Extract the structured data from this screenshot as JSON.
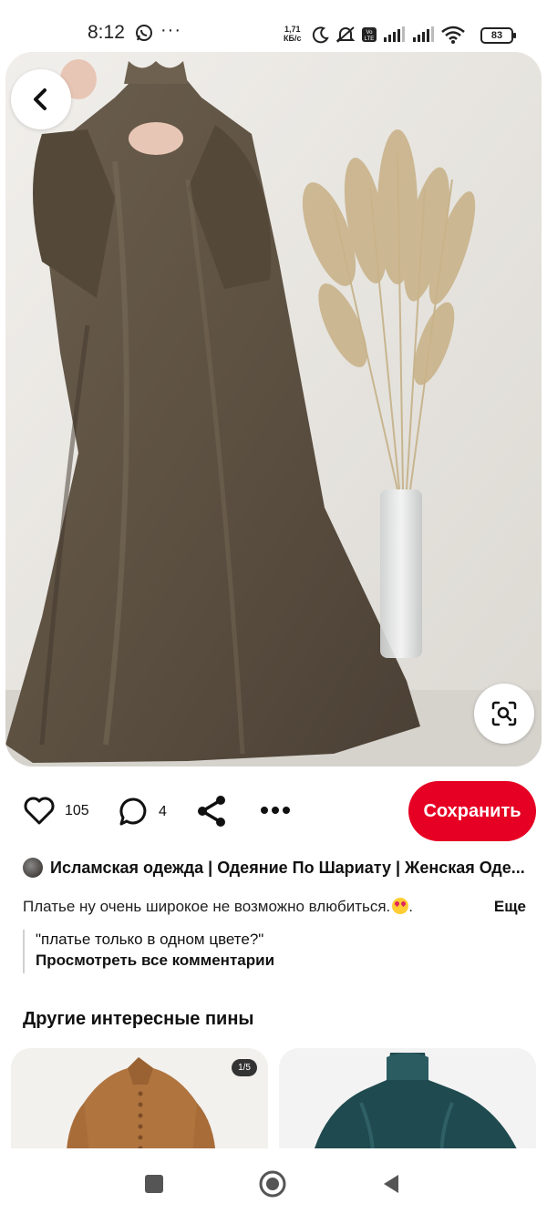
{
  "status_bar": {
    "time": "8:12",
    "more": "···",
    "speed_value": "1,71",
    "speed_unit": "КБ/с",
    "battery": "83",
    "icons": [
      "whatsapp-icon",
      "moon-icon",
      "mute-icon",
      "volte-icon",
      "signal-icon",
      "signal-icon",
      "wifi-icon"
    ]
  },
  "pin": {
    "likes": "105",
    "comments": "4",
    "save_label": "Сохранить",
    "board_name": "Исламская одежда | Одеяние По Шариату | Женская Оде...",
    "description": "Платье ну очень широкое не возможно влюбиться.",
    "description_tail": ".",
    "more_label": "Еще",
    "comment_text": "\"платье только в одном цвете?\"",
    "view_all_comments": "Просмотреть все комментарии"
  },
  "related": {
    "title": "Другие интересные пины",
    "cards": [
      {
        "badge": "1/5"
      },
      {
        "badge": ""
      }
    ]
  },
  "colors": {
    "save_red": "#e60023",
    "dress_brown": "#5d5142",
    "background": "#ffffff"
  }
}
